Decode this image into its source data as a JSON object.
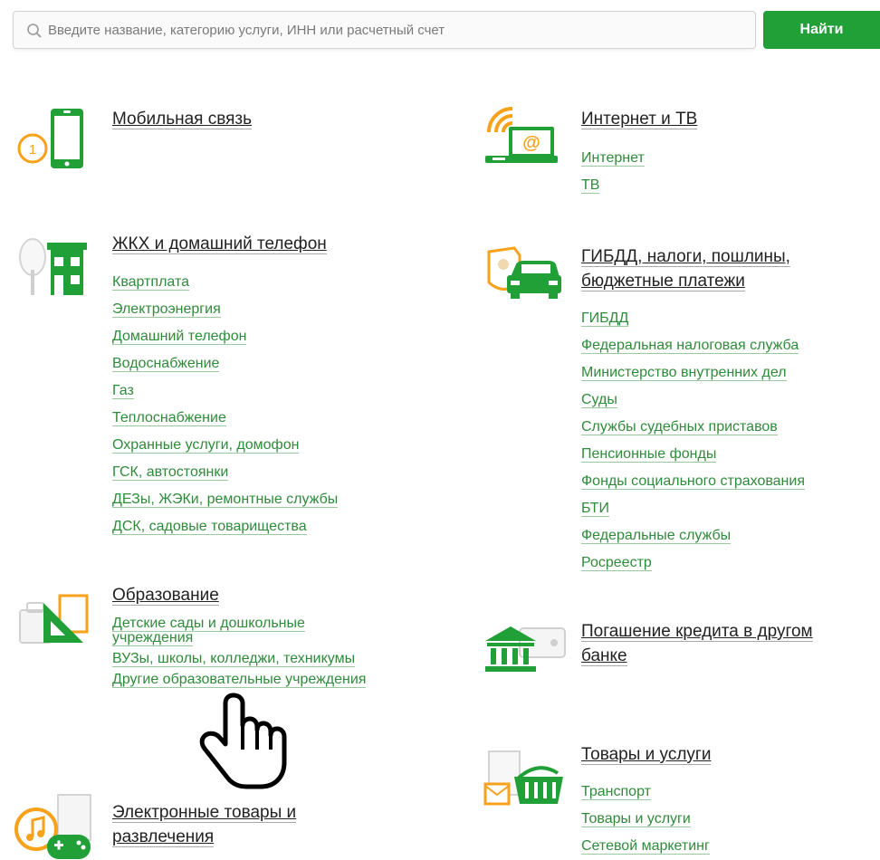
{
  "search": {
    "placeholder": "Введите название, категорию услуги, ИНН или расчетный счет",
    "button_label": "Найти"
  },
  "colors": {
    "accent": "#21a038",
    "orange": "#f7a21a",
    "link": "#2f8b3a"
  },
  "categories": {
    "mobile": {
      "title": "Мобильная связь",
      "icon": "mobile-phone-icon",
      "links": []
    },
    "internet": {
      "title": "Интернет и ТВ",
      "icon": "laptop-wifi-icon",
      "links": [
        "Интернет",
        "ТВ"
      ]
    },
    "utilities": {
      "title": "ЖКХ и домашний телефон",
      "icon": "house-tree-icon",
      "links": [
        "Квартплата",
        "Электроэнергия",
        "Домашний телефон",
        "Водоснабжение",
        "Газ",
        "Теплоснабжение",
        "Охранные услуги, домофон",
        "ГСК, автостоянки",
        "ДЕЗы, ЖЭКи, ремонтные службы",
        "ДСК, садовые товарищества"
      ]
    },
    "gibdd": {
      "title_line1": "ГИБДД, налоги, пошлины,",
      "title_line2": "бюджетные платежи",
      "icon": "car-emblem-icon",
      "links": [
        "ГИБДД",
        "Федеральная налоговая служба",
        "Министерство внутренних дел",
        "Суды",
        "Службы судебных приставов",
        "Пенсионные фонды",
        "Фонды социального страхования",
        "БТИ",
        "Федеральные службы",
        "Росреестр"
      ]
    },
    "education": {
      "title": "Образование",
      "icon": "ruler-triangle-icon",
      "links": [
        "Детские сады и дошкольные учреждения",
        "ВУЗы, школы, колледжи, техникумы",
        "Другие образовательные учреждения"
      ]
    },
    "credit": {
      "title_line1": "Погашение кредита в другом",
      "title_line2": "банке",
      "icon": "bank-building-icon",
      "links": []
    },
    "goods": {
      "title": "Товары и услуги",
      "icon": "shopping-basket-icon",
      "links": [
        "Транспорт",
        "Товары и услуги",
        "Сетевой маркетинг"
      ]
    },
    "electronics": {
      "title_line1": "Электронные товары и",
      "title_line2": "развлечения",
      "icon": "music-gamepad-icon",
      "links": []
    }
  }
}
